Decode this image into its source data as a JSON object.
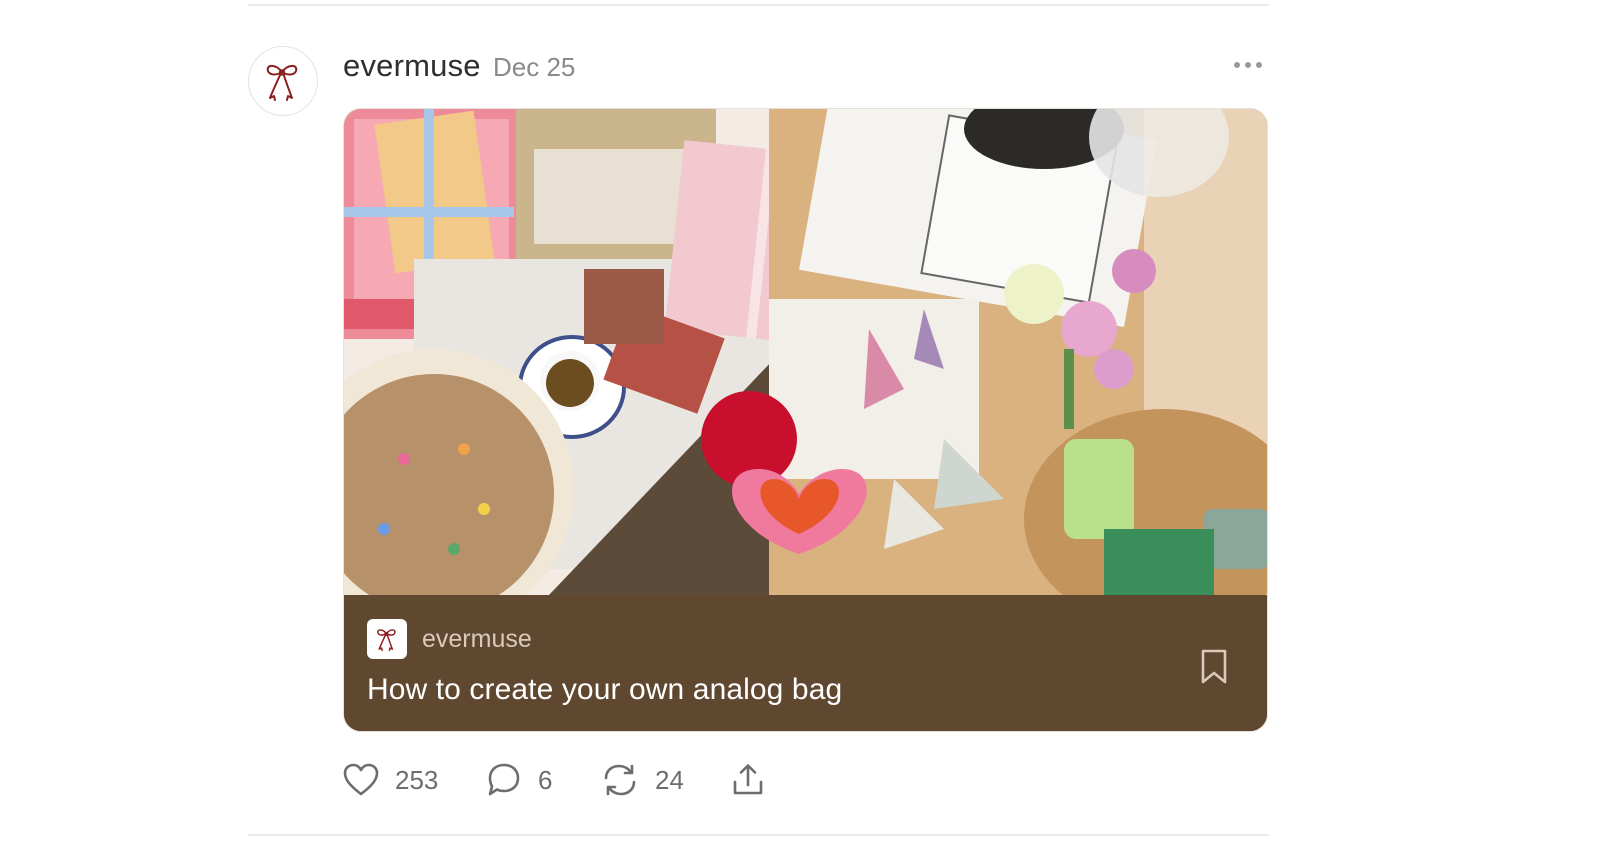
{
  "post": {
    "author": "evermuse",
    "date": "Dec 25",
    "more_icon": "more-horizontal-icon"
  },
  "card": {
    "publication": "evermuse",
    "title": "How to create your own analog bag",
    "footer_color": "#604730",
    "bookmark_icon": "bookmark-icon"
  },
  "actions": {
    "likes": "253",
    "comments": "6",
    "restacks": "24",
    "share_icon": "share-icon"
  },
  "colors": {
    "text_primary": "#2f2f2f",
    "text_muted": "#8a8a8a",
    "divider": "#e9e9e9",
    "bow": "#8b1e1e"
  }
}
